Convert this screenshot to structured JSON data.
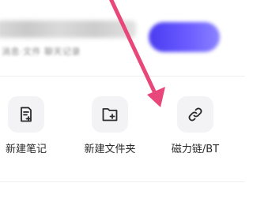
{
  "top": {
    "subtitle": "消息·文件 聊天记录"
  },
  "actions": [
    {
      "label": "新建笔记",
      "icon": "new-note-icon"
    },
    {
      "label": "新建文件夹",
      "icon": "new-folder-icon"
    },
    {
      "label": "磁力链/BT",
      "icon": "link-icon"
    }
  ],
  "annotation": {
    "color": "#e8477a"
  },
  "colors": {
    "accent": "#5b4df5",
    "icon_bg": "#f3f3f5"
  }
}
